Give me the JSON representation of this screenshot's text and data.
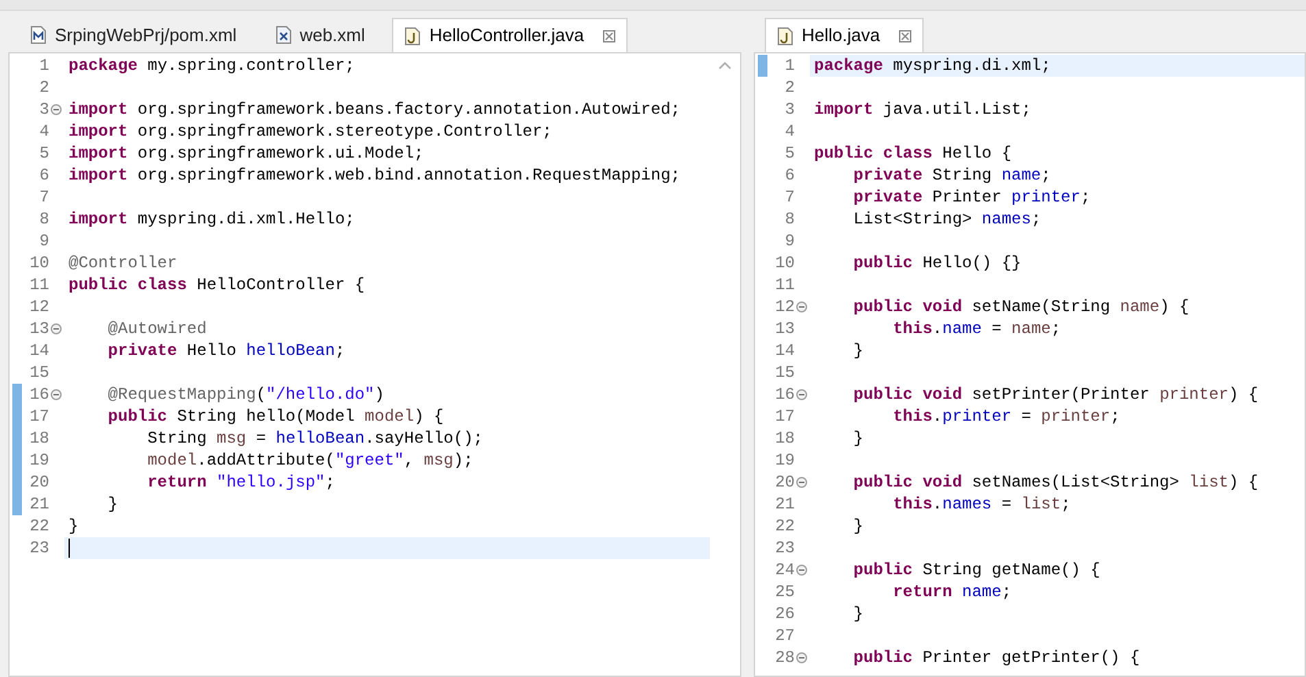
{
  "editors": [
    {
      "tabs": [
        {
          "label": "SrpingWebPrj/pom.xml",
          "kind": "maven",
          "selected": false
        },
        {
          "label": "web.xml",
          "kind": "xml",
          "selected": false
        },
        {
          "label": "HelloController.java",
          "kind": "java",
          "selected": true
        }
      ],
      "lines": [
        {
          "number": "1",
          "fold": false,
          "changed": false,
          "current": false,
          "tokens": [
            {
              "kind": "keyword",
              "text": "package"
            },
            {
              "kind": "plain",
              "text": " my.spring.controller;"
            }
          ]
        },
        {
          "number": "2",
          "fold": false,
          "changed": false,
          "current": false
        },
        {
          "number": "3",
          "fold": true,
          "changed": false,
          "current": false,
          "tokens": [
            {
              "kind": "keyword",
              "text": "import"
            },
            {
              "kind": "plain",
              "text": " org.springframework.beans.factory.annotation.Autowired;"
            }
          ]
        },
        {
          "number": "4",
          "fold": false,
          "changed": false,
          "current": false,
          "tokens": [
            {
              "kind": "keyword",
              "text": "import"
            },
            {
              "kind": "plain",
              "text": " org.springframework.stereotype.Controller;"
            }
          ]
        },
        {
          "number": "5",
          "fold": false,
          "changed": false,
          "current": false,
          "tokens": [
            {
              "kind": "keyword",
              "text": "import"
            },
            {
              "kind": "plain",
              "text": " org.springframework.ui.Model;"
            }
          ]
        },
        {
          "number": "6",
          "fold": false,
          "changed": false,
          "current": false,
          "tokens": [
            {
              "kind": "keyword",
              "text": "import"
            },
            {
              "kind": "plain",
              "text": " org.springframework.web.bind.annotation.RequestMapping;"
            }
          ]
        },
        {
          "number": "7",
          "fold": false,
          "changed": false,
          "current": false
        },
        {
          "number": "8",
          "fold": false,
          "changed": false,
          "current": false,
          "tokens": [
            {
              "kind": "keyword",
              "text": "import"
            },
            {
              "kind": "plain",
              "text": " myspring.di.xml.Hello;"
            }
          ]
        },
        {
          "number": "9",
          "fold": false,
          "changed": false,
          "current": false
        },
        {
          "number": "10",
          "fold": false,
          "changed": false,
          "current": false,
          "tokens": [
            {
              "kind": "annotation",
              "text": "@Controller"
            }
          ]
        },
        {
          "number": "11",
          "fold": false,
          "changed": false,
          "current": false,
          "tokens": [
            {
              "kind": "keyword",
              "text": "public class"
            },
            {
              "kind": "plain",
              "text": " HelloController {"
            }
          ]
        },
        {
          "number": "12",
          "fold": false,
          "changed": false,
          "current": false
        },
        {
          "number": "13",
          "fold": true,
          "changed": false,
          "current": false,
          "tokens": [
            {
              "kind": "annotation",
              "text": "    @Autowired"
            }
          ]
        },
        {
          "number": "14",
          "fold": false,
          "changed": false,
          "current": false,
          "tokens": [
            {
              "kind": "keyword",
              "text": "    private"
            },
            {
              "kind": "plain",
              "text": " Hello "
            },
            {
              "kind": "field",
              "text": "helloBean"
            },
            {
              "kind": "plain",
              "text": ";"
            }
          ]
        },
        {
          "number": "15",
          "fold": false,
          "changed": false,
          "current": false
        },
        {
          "number": "16",
          "fold": true,
          "changed": true,
          "current": false,
          "tokens": [
            {
              "kind": "annotation",
              "text": "    @RequestMapping"
            },
            {
              "kind": "plain",
              "text": "("
            },
            {
              "kind": "string",
              "text": "\"/hello.do\""
            },
            {
              "kind": "plain",
              "text": ")"
            }
          ]
        },
        {
          "number": "17",
          "fold": false,
          "changed": true,
          "current": false,
          "tokens": [
            {
              "kind": "keyword",
              "text": "    public"
            },
            {
              "kind": "plain",
              "text": " String hello(Model "
            },
            {
              "kind": "local",
              "text": "model"
            },
            {
              "kind": "plain",
              "text": ") {"
            }
          ]
        },
        {
          "number": "18",
          "fold": false,
          "changed": true,
          "current": false,
          "tokens": [
            {
              "kind": "plain",
              "text": "        String "
            },
            {
              "kind": "local",
              "text": "msg"
            },
            {
              "kind": "plain",
              "text": " = "
            },
            {
              "kind": "field",
              "text": "helloBean"
            },
            {
              "kind": "plain",
              "text": ".sayHello();"
            }
          ]
        },
        {
          "number": "19",
          "fold": false,
          "changed": true,
          "current": false,
          "tokens": [
            {
              "kind": "local",
              "text": "        model"
            },
            {
              "kind": "plain",
              "text": ".addAttribute("
            },
            {
              "kind": "string",
              "text": "\"greet\""
            },
            {
              "kind": "plain",
              "text": ", "
            },
            {
              "kind": "local",
              "text": "msg"
            },
            {
              "kind": "plain",
              "text": ");"
            }
          ]
        },
        {
          "number": "20",
          "fold": false,
          "changed": true,
          "current": false,
          "tokens": [
            {
              "kind": "keyword",
              "text": "        return"
            },
            {
              "kind": "string",
              "text": " \"hello.jsp\""
            },
            {
              "kind": "plain",
              "text": ";"
            }
          ]
        },
        {
          "number": "21",
          "fold": false,
          "changed": true,
          "current": false,
          "tokens": [
            {
              "kind": "plain",
              "text": "    }"
            }
          ]
        },
        {
          "number": "22",
          "fold": false,
          "changed": false,
          "current": false,
          "tokens": [
            {
              "kind": "plain",
              "text": "}"
            }
          ]
        },
        {
          "number": "23",
          "fold": false,
          "changed": false,
          "current": true
        }
      ]
    },
    {
      "tabs": [
        {
          "label": "Hello.java",
          "kind": "java",
          "selected": true
        }
      ],
      "lines": [
        {
          "number": "1",
          "fold": false,
          "changed": true,
          "current": true,
          "tokens": [
            {
              "kind": "keyword",
              "text": "package"
            },
            {
              "kind": "plain",
              "text": " myspring.di.xml;"
            }
          ]
        },
        {
          "number": "2",
          "fold": false,
          "changed": false,
          "current": false
        },
        {
          "number": "3",
          "fold": false,
          "changed": false,
          "current": false,
          "tokens": [
            {
              "kind": "keyword",
              "text": "import"
            },
            {
              "kind": "plain",
              "text": " java.util.List;"
            }
          ]
        },
        {
          "number": "4",
          "fold": false,
          "changed": false,
          "current": false
        },
        {
          "number": "5",
          "fold": false,
          "changed": false,
          "current": false,
          "tokens": [
            {
              "kind": "keyword",
              "text": "public class"
            },
            {
              "kind": "plain",
              "text": " Hello {"
            }
          ]
        },
        {
          "number": "6",
          "fold": false,
          "changed": false,
          "current": false,
          "tokens": [
            {
              "kind": "keyword",
              "text": "    private"
            },
            {
              "kind": "plain",
              "text": " String "
            },
            {
              "kind": "field",
              "text": "name"
            },
            {
              "kind": "plain",
              "text": ";"
            }
          ]
        },
        {
          "number": "7",
          "fold": false,
          "changed": false,
          "current": false,
          "tokens": [
            {
              "kind": "keyword",
              "text": "    private"
            },
            {
              "kind": "plain",
              "text": " Printer "
            },
            {
              "kind": "field",
              "text": "printer"
            },
            {
              "kind": "plain",
              "text": ";"
            }
          ]
        },
        {
          "number": "8",
          "fold": false,
          "changed": false,
          "current": false,
          "tokens": [
            {
              "kind": "plain",
              "text": "    List<String> "
            },
            {
              "kind": "field",
              "text": "names"
            },
            {
              "kind": "plain",
              "text": ";"
            }
          ]
        },
        {
          "number": "9",
          "fold": false,
          "changed": false,
          "current": false
        },
        {
          "number": "10",
          "fold": false,
          "changed": false,
          "current": false,
          "tokens": [
            {
              "kind": "keyword",
              "text": "    public"
            },
            {
              "kind": "plain",
              "text": " Hello() {}"
            }
          ]
        },
        {
          "number": "11",
          "fold": false,
          "changed": false,
          "current": false
        },
        {
          "number": "12",
          "fold": true,
          "changed": false,
          "current": false,
          "tokens": [
            {
              "kind": "keyword",
              "text": "    public void"
            },
            {
              "kind": "plain",
              "text": " setName(String "
            },
            {
              "kind": "local",
              "text": "name"
            },
            {
              "kind": "plain",
              "text": ") {"
            }
          ]
        },
        {
          "number": "13",
          "fold": false,
          "changed": false,
          "current": false,
          "tokens": [
            {
              "kind": "keyword",
              "text": "        this"
            },
            {
              "kind": "plain",
              "text": "."
            },
            {
              "kind": "field",
              "text": "name"
            },
            {
              "kind": "plain",
              "text": " = "
            },
            {
              "kind": "local",
              "text": "name"
            },
            {
              "kind": "plain",
              "text": ";"
            }
          ]
        },
        {
          "number": "14",
          "fold": false,
          "changed": false,
          "current": false,
          "tokens": [
            {
              "kind": "plain",
              "text": "    }"
            }
          ]
        },
        {
          "number": "15",
          "fold": false,
          "changed": false,
          "current": false
        },
        {
          "number": "16",
          "fold": true,
          "changed": false,
          "current": false,
          "tokens": [
            {
              "kind": "keyword",
              "text": "    public void"
            },
            {
              "kind": "plain",
              "text": " setPrinter(Printer "
            },
            {
              "kind": "local",
              "text": "printer"
            },
            {
              "kind": "plain",
              "text": ") {"
            }
          ]
        },
        {
          "number": "17",
          "fold": false,
          "changed": false,
          "current": false,
          "tokens": [
            {
              "kind": "keyword",
              "text": "        this"
            },
            {
              "kind": "plain",
              "text": "."
            },
            {
              "kind": "field",
              "text": "printer"
            },
            {
              "kind": "plain",
              "text": " = "
            },
            {
              "kind": "local",
              "text": "printer"
            },
            {
              "kind": "plain",
              "text": ";"
            }
          ]
        },
        {
          "number": "18",
          "fold": false,
          "changed": false,
          "current": false,
          "tokens": [
            {
              "kind": "plain",
              "text": "    }"
            }
          ]
        },
        {
          "number": "19",
          "fold": false,
          "changed": false,
          "current": false
        },
        {
          "number": "20",
          "fold": true,
          "changed": false,
          "current": false,
          "tokens": [
            {
              "kind": "keyword",
              "text": "    public void"
            },
            {
              "kind": "plain",
              "text": " setNames(List<String> "
            },
            {
              "kind": "local",
              "text": "list"
            },
            {
              "kind": "plain",
              "text": ") {"
            }
          ]
        },
        {
          "number": "21",
          "fold": false,
          "changed": false,
          "current": false,
          "tokens": [
            {
              "kind": "keyword",
              "text": "        this"
            },
            {
              "kind": "plain",
              "text": "."
            },
            {
              "kind": "field",
              "text": "names"
            },
            {
              "kind": "plain",
              "text": " = "
            },
            {
              "kind": "local",
              "text": "list"
            },
            {
              "kind": "plain",
              "text": ";"
            }
          ]
        },
        {
          "number": "22",
          "fold": false,
          "changed": false,
          "current": false,
          "tokens": [
            {
              "kind": "plain",
              "text": "    }"
            }
          ]
        },
        {
          "number": "23",
          "fold": false,
          "changed": false,
          "current": false
        },
        {
          "number": "24",
          "fold": true,
          "changed": false,
          "current": false,
          "tokens": [
            {
              "kind": "keyword",
              "text": "    public"
            },
            {
              "kind": "plain",
              "text": " String getName() {"
            }
          ]
        },
        {
          "number": "25",
          "fold": false,
          "changed": false,
          "current": false,
          "tokens": [
            {
              "kind": "keyword",
              "text": "        return"
            },
            {
              "kind": "field",
              "text": " name"
            },
            {
              "kind": "plain",
              "text": ";"
            }
          ]
        },
        {
          "number": "26",
          "fold": false,
          "changed": false,
          "current": false,
          "tokens": [
            {
              "kind": "plain",
              "text": "    }"
            }
          ]
        },
        {
          "number": "27",
          "fold": false,
          "changed": false,
          "current": false
        },
        {
          "number": "28",
          "fold": true,
          "changed": false,
          "current": false,
          "tokens": [
            {
              "kind": "keyword",
              "text": "    public"
            },
            {
              "kind": "plain",
              "text": " Printer getPrinter() {"
            }
          ]
        }
      ]
    }
  ]
}
